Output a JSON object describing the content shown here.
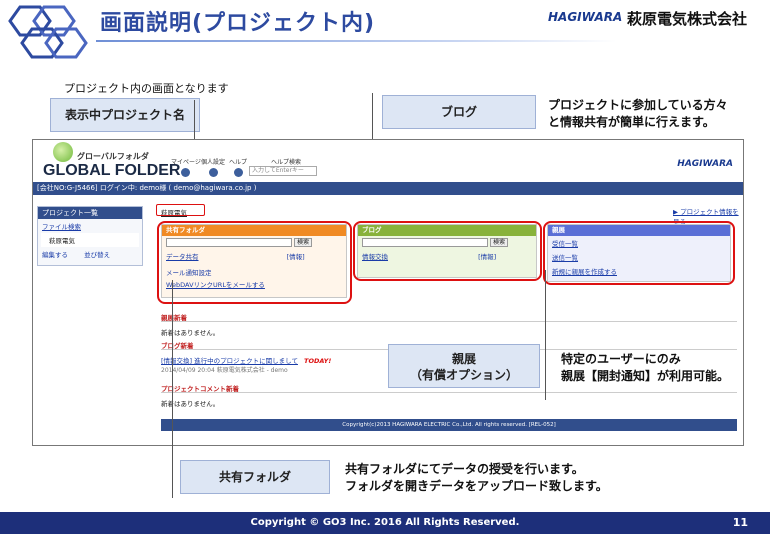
{
  "slide": {
    "title": "画面説明(プロジェクト内)",
    "company_logo_text": "HAGIWARA",
    "company_name": "萩原電気株式会社",
    "top_note": "プロジェクト内の画面となります",
    "footer": "Copyright © GO3 Inc. 2016  All Rights Reserved.",
    "page_number": "11"
  },
  "callouts": {
    "project_name": "表示中プロジェクト名",
    "blog": "ブログ",
    "blog_desc_1": "プロジェクトに参加している方々",
    "blog_desc_2": "と情報共有が簡単に行えます。",
    "shinten": "親展",
    "shinten_sub": "（有償オプション）",
    "shinten_desc_1": "特定のユーザーにのみ",
    "shinten_desc_2": "親展【開封通知】が利用可能。",
    "folder": "共有フォルダ",
    "folder_desc_1": "共有フォルダにてデータの授受を行います。",
    "folder_desc_2": "フォルダを開きデータをアップロード致します。"
  },
  "app": {
    "brand_small": "グローバルフォルダ",
    "brand_big": "GLOBAL FOLDER",
    "nav": [
      "マイページ",
      "個人設定",
      "ヘルプ"
    ],
    "help_search_label": "ヘルプ検索",
    "help_search_placeholder": "入力してEnterキー",
    "logo": "HAGIWARA",
    "user_bar": "[会社NO:G-J5466] ログイン中: demo様 ( demo@hagiwara.co.jp )",
    "sidebar_title": "プロジェクト一覧",
    "sidebar_search": "ファイル検索",
    "sidebar_company": "萩原電気",
    "sidebar_edit": "編集する",
    "sidebar_sort": "並び替え",
    "current_project": "萩原電気",
    "project_info_link": "▶ プロジェクト情報を見る",
    "folder_panel": {
      "title": "共有フォルダ",
      "search_btn": "検索",
      "item": "データ共有",
      "item_tag": "[情報]",
      "mail_setting": "メール通知設定",
      "webdav": "WebDAVリンクURLをメールする"
    },
    "blog_panel": {
      "title": "ブログ",
      "search_btn": "検索",
      "item": "情報交換",
      "item_tag": "[情報]"
    },
    "shinten_panel": {
      "title": "親展",
      "received": "受信一覧",
      "sent": "送信一覧",
      "create": "新規に親展を作成する"
    },
    "sections": {
      "shinten_new": "親展新着",
      "shinten_none": "新着はありません。",
      "blog_new": "ブログ新着",
      "blog_entry": "[情報交換] 進行中のプロジェクトに関しまして",
      "blog_today": "TODAY!",
      "blog_meta": "2014/04/09 20:04 萩原電気株式会社 - demo",
      "comment_new": "プロジェクトコメント新着",
      "comment_none": "新着はありません。"
    },
    "copyright": "Copyright(c)2013 HAGIWARA ELECTRIC Co.,Ltd. All rights reserved. [REL-052]"
  },
  "colors": {
    "title_blue": "#2d4aa0",
    "app_navy": "#314e8c",
    "folder_orange": "#f08a24",
    "blog_green": "#88b23b",
    "shinten_blue": "#5a6fd6",
    "highlight_red": "#d11111"
  }
}
